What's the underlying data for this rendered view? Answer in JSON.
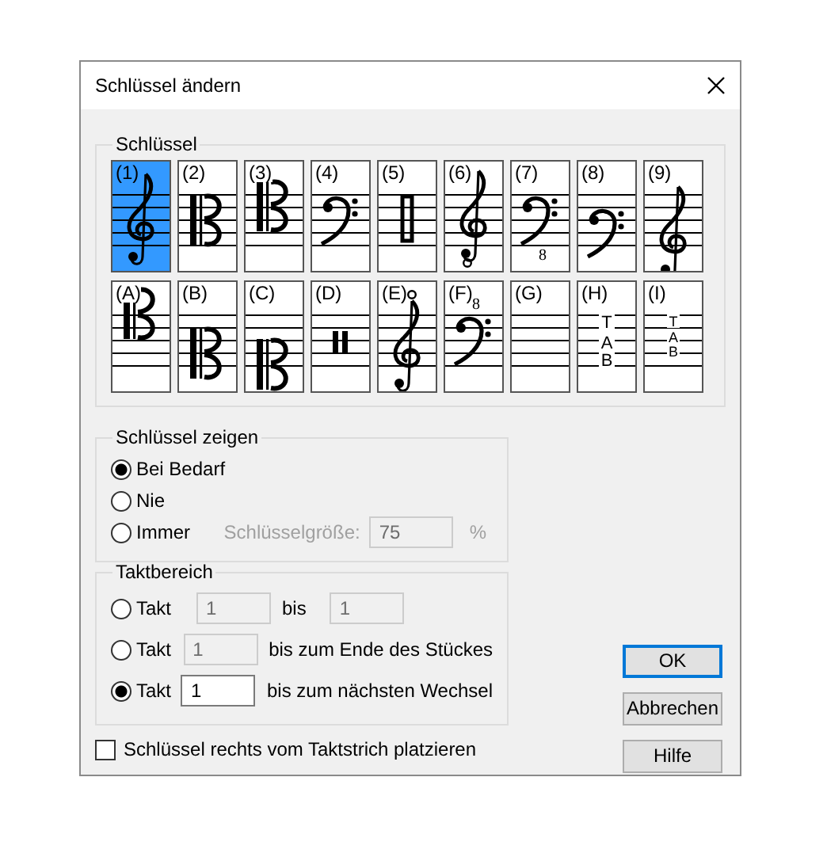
{
  "window": {
    "title": "Schlüssel ändern"
  },
  "clef_group": {
    "label": "Schlüssel",
    "clefs": [
      {
        "label": "(1)",
        "kind": "g-line2",
        "selected": true
      },
      {
        "label": "(2)",
        "kind": "c-line3",
        "selected": false
      },
      {
        "label": "(3)",
        "kind": "c-line2",
        "selected": false
      },
      {
        "label": "(4)",
        "kind": "f-line2",
        "selected": false
      },
      {
        "label": "(5)",
        "kind": "perc-rect",
        "selected": false
      },
      {
        "label": "(6)",
        "kind": "g-8vb",
        "selected": false
      },
      {
        "label": "(7)",
        "kind": "f-8vb",
        "octave": "8",
        "selected": false
      },
      {
        "label": "(8)",
        "kind": "f-line3",
        "selected": false
      },
      {
        "label": "(9)",
        "kind": "g-line1",
        "selected": false
      },
      {
        "label": "(A)",
        "kind": "c-line1",
        "selected": false
      },
      {
        "label": "(B)",
        "kind": "c-line4",
        "selected": false
      },
      {
        "label": "(C)",
        "kind": "c-line5",
        "selected": false
      },
      {
        "label": "(D)",
        "kind": "perc-bars",
        "selected": false
      },
      {
        "label": "(E)",
        "kind": "g-8va",
        "selected": false
      },
      {
        "label": "(F)",
        "kind": "f-8va",
        "octave": "8",
        "selected": false
      },
      {
        "label": "(G)",
        "kind": "none",
        "selected": false
      },
      {
        "label": "(H)",
        "kind": "tab",
        "letters": [
          "T",
          "A",
          "B"
        ],
        "selected": false
      },
      {
        "label": "(I)",
        "kind": "tab-small",
        "letters": [
          "T",
          "A",
          "B"
        ],
        "selected": false
      }
    ]
  },
  "show_group": {
    "label": "Schlüssel zeigen",
    "options": [
      {
        "label": "Bei Bedarf",
        "selected": true
      },
      {
        "label": "Nie",
        "selected": false
      },
      {
        "label": "Immer",
        "selected": false
      }
    ],
    "size_label": "Schlüsselgröße:",
    "size_value": "75",
    "size_unit": "%",
    "size_disabled": true
  },
  "range_group": {
    "label": "Taktbereich",
    "rows": [
      {
        "label": "Takt",
        "selected": false,
        "from": "1",
        "disabled": true,
        "middle": "bis",
        "to": "1"
      },
      {
        "label": "Takt",
        "selected": false,
        "from": "1",
        "disabled": true,
        "suffix": "bis zum Ende des Stückes"
      },
      {
        "label": "Takt",
        "selected": true,
        "from": "1",
        "disabled": false,
        "suffix": "bis zum nächsten Wechsel"
      }
    ]
  },
  "checkbox": {
    "label": "Schlüssel rechts vom Taktstrich platzieren",
    "checked": false
  },
  "buttons": [
    {
      "label": "OK",
      "default": true
    },
    {
      "label": "Abbrechen",
      "default": false
    },
    {
      "label": "Hilfe",
      "default": false
    }
  ]
}
